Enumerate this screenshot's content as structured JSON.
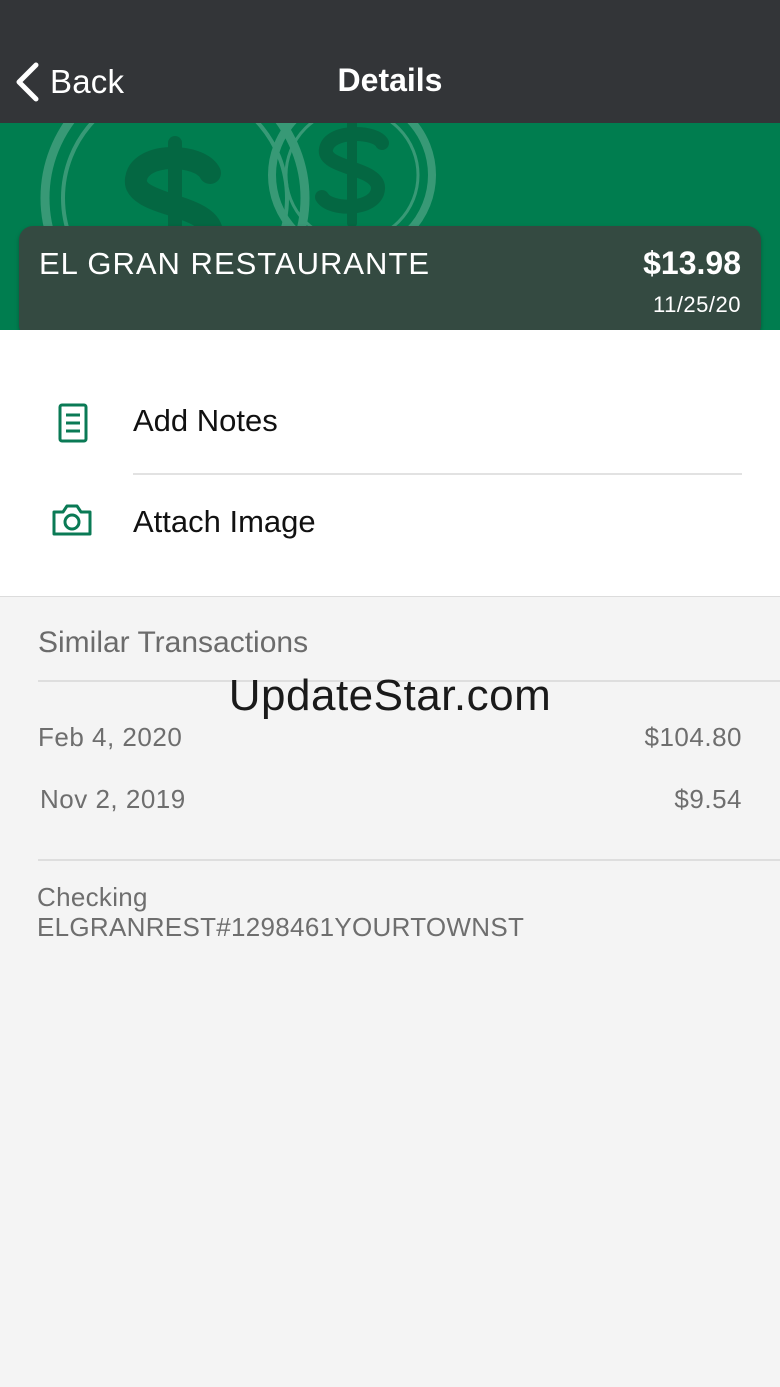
{
  "navbar": {
    "back_label": "Back",
    "title": "Details"
  },
  "merchant": {
    "name": "EL GRAN RESTAURANTE",
    "amount": "$13.98",
    "date": "11/25/20"
  },
  "actions": [
    {
      "label": "Add Notes",
      "icon": "notes-icon"
    },
    {
      "label": "Attach Image",
      "icon": "camera-icon"
    }
  ],
  "similar": {
    "title": "Similar Transactions",
    "transactions": [
      {
        "date": "Feb 4, 2020",
        "amount": "$104.80"
      },
      {
        "date": "Nov 2, 2019",
        "amount": "$9.54"
      }
    ]
  },
  "account": {
    "type": "Checking",
    "description": "ELGRANREST#1298461YOURTOWNST"
  },
  "watermark": "UpdateStar.com",
  "colors": {
    "navbar": "#333538",
    "banner_green": "#007d4f",
    "card": "#344a41",
    "icon_green": "#0a7a55",
    "background": "#f4f4f4"
  }
}
